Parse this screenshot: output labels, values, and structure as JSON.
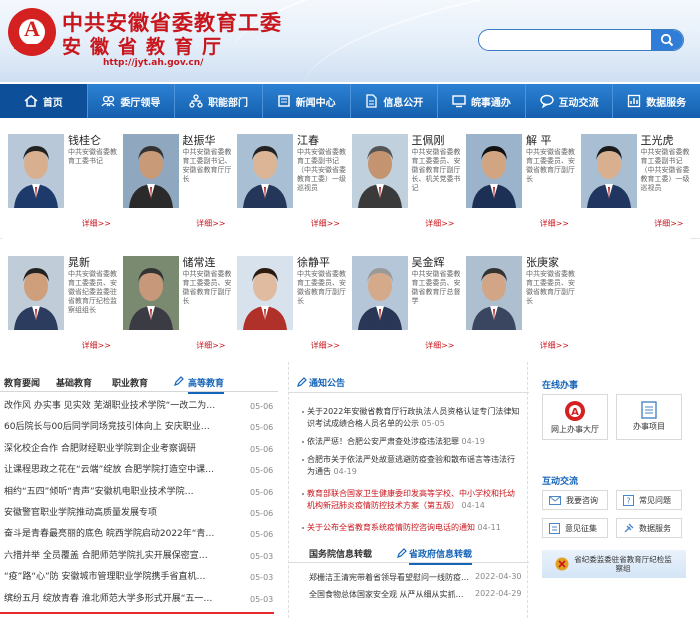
{
  "header": {
    "title1": "中共安徽省委教育工委",
    "title2": "安徽省教育厅",
    "url": "http://jyt.ah.gov.cn/",
    "logo_char": "A",
    "search_placeholder": ""
  },
  "nav": [
    {
      "label": "首页",
      "icon": "home-icon"
    },
    {
      "label": "委厅领导",
      "icon": "users-icon"
    },
    {
      "label": "职能部门",
      "icon": "org-chart-icon"
    },
    {
      "label": "新闻中心",
      "icon": "news-icon"
    },
    {
      "label": "信息公开",
      "icon": "document-icon"
    },
    {
      "label": "皖事通办",
      "icon": "monitor-icon"
    },
    {
      "label": "互动交流",
      "icon": "chat-icon"
    },
    {
      "label": "数据服务",
      "icon": "chart-icon"
    }
  ],
  "leaders": [
    {
      "name": "钱桂仑",
      "desc": "中共安徽省委教育工委书记",
      "more": "详细>>"
    },
    {
      "name": "赵振华",
      "desc": "中共安徽省委教育工委副书记、安徽省教育厅厅长",
      "more": "详细>>"
    },
    {
      "name": "江春",
      "desc": "中共安徽省委教育工委副书记（中共安徽省委教育工委）一级巡视员",
      "more": "详细>>"
    },
    {
      "name": "王佩刚",
      "desc": "中共安徽省委教育工委委员、安徽省教育厅副厅长、机关党委书记",
      "more": "详细>>"
    },
    {
      "name": "解 平",
      "desc": "中共安徽省委教育工委委员、安徽省教育厅副厅长",
      "more": "详细>>"
    },
    {
      "name": "王光虎",
      "desc": "中共安徽省委教育工委副书记（中共安徽省委教育工委）一级巡视员",
      "more": "详细>>"
    },
    {
      "name": "晁新",
      "desc": "中共安徽省委教育工委委员、安徽省纪委监委驻省教育厅纪检监察组组长",
      "more": "详细>>"
    },
    {
      "name": "储常连",
      "desc": "中共安徽省委教育工委委员、安徽省教育厅副厅长",
      "more": "详细>>"
    },
    {
      "name": "徐静平",
      "desc": "中共安徽省委教育工委委员、安徽省教育厅副厅长",
      "more": "详细>>"
    },
    {
      "name": "吴金辉",
      "desc": "中共安徽省委教育工委委员、安徽省教育厅总督学",
      "more": "详细>>"
    },
    {
      "name": "张庚家",
      "desc": "中共安徽省委教育工委委员、安徽省教育厅副厅长",
      "more": "详细>>"
    }
  ],
  "news_tabs": [
    "教育要闻",
    "基础教育",
    "职业教育",
    "高等教育"
  ],
  "news": [
    {
      "title": "改作风 办实事 见实效 芜湖职业技术学院“一改二为…",
      "date": "05-06"
    },
    {
      "title": "60后院长与00后同学同场竞技引体向上 安庆职业技…",
      "date": "05-06"
    },
    {
      "title": "深化校企合作 合肥财经职业学院到企业考察调研",
      "date": "05-06"
    },
    {
      "title": "让课程思政之花在“云端”绽放 合肥学院打造空中课…",
      "date": "05-06"
    },
    {
      "title": "相约“五四”倾听“青声”安徽机电职业技术学院…",
      "date": "05-06"
    },
    {
      "title": "安徽警官职业学院推动高质量发展专项",
      "date": "05-06"
    },
    {
      "title": "奋斗是青春最亮丽的底色 皖西学院启动2022年“青…",
      "date": "05-06"
    },
    {
      "title": "六措并举 全员覆盖 合肥师范学院扎实开展保密宣传…",
      "date": "05-03"
    },
    {
      "title": "“疫”路“心”防 安徽城市管理职业学院携手省直机…",
      "date": "05-03"
    },
    {
      "title": "缤纷五月 绽放青春 淮北师范大学多形式开展“五一…",
      "date": "05-03"
    }
  ],
  "notice_header": "通知公告",
  "notices": [
    {
      "title": "关于2022年安徽省教育厅行政执法人员资格认证专门法律知识考试成绩合格人员名单的公示",
      "date": "05-05",
      "red": false
    },
    {
      "title": "依法严惩！合肥公安严肃查处涉疫违法犯罪",
      "date": "04-19",
      "red": false
    },
    {
      "title": "合肥市关于依法严处故意逃避防疫查验和散布谣言等违法行为通告",
      "date": "04-19",
      "red": false
    },
    {
      "title": "教育部联合国家卫生健康委印发高等学校、中小学校和托幼机构新冠肺炎疫情防控技术方案（第五版）",
      "date": "04-14",
      "red": true
    },
    {
      "title": "关于公布全省教育系统疫情防控咨询电话的通知",
      "date": "04-11",
      "red": true
    }
  ],
  "gov_tabs": [
    "国务院信息转载",
    "省政府信息转载"
  ],
  "gov_news": [
    {
      "title": "郑栅洁王清宪带着省领导看望慰问一线防疫人…",
      "date": "2022-04-30"
    },
    {
      "title": "全国食物总体国家安全观 从严从细从实抓…",
      "date": "2022-04-29"
    }
  ],
  "online": {
    "header": "在线办事",
    "items": [
      "网上办事大厅",
      "办事项目"
    ]
  },
  "interact": {
    "header": "互动交流",
    "items": [
      "我要咨询",
      "常见问题",
      "意见征集",
      "数据服务"
    ]
  },
  "banner": "省纪委监委驻省教育厅纪检监察组",
  "colors": {
    "brand_red": "#c8161d",
    "nav_blue": "#1a6cc0",
    "link_blue": "#1565b8"
  }
}
